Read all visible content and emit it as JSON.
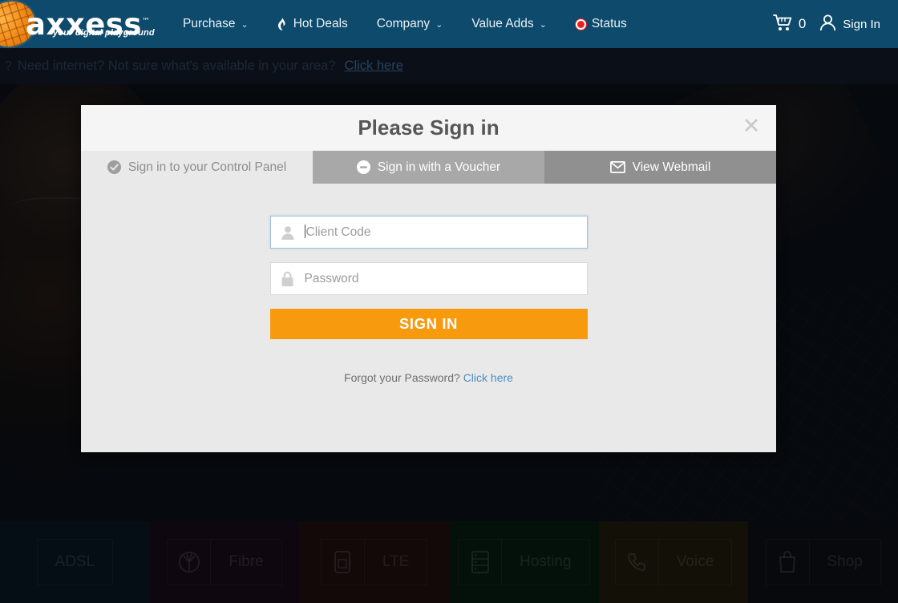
{
  "navbar": {
    "logo": {
      "word": "axxess",
      "tm": "™",
      "tagline": "your digital playground",
      "icon": "globe-icon"
    },
    "items": [
      {
        "label": "Purchase",
        "caret": "⌄",
        "icon": null
      },
      {
        "label": "Hot Deals",
        "caret": "",
        "icon": "flame-icon"
      },
      {
        "label": "Company",
        "caret": "⌄",
        "icon": null
      },
      {
        "label": "Value Adds",
        "caret": "⌄",
        "icon": null
      },
      {
        "label": "Status",
        "caret": "",
        "icon": "status-dot-icon"
      }
    ],
    "cart": {
      "icon": "cart-icon",
      "count": "0"
    },
    "signin": {
      "icon": "user-icon",
      "label": "Sign In"
    }
  },
  "banner": {
    "question_mark": "?",
    "text": "Need internet? Not sure what's available in your area?",
    "link": "Click here"
  },
  "modal": {
    "title": "Please Sign in",
    "close_icon": "close-icon",
    "tabs": [
      {
        "label": "Sign in to your Control Panel",
        "icon": "check-circle-icon",
        "state": "active"
      },
      {
        "label": "Sign in with a Voucher",
        "icon": "minus-circle-icon",
        "state": "inactive"
      },
      {
        "label": "View Webmail",
        "icon": "envelope-icon",
        "state": "inactive"
      }
    ],
    "fields": [
      {
        "name": "client-code",
        "placeholder": "Client Code",
        "value": "",
        "icon": "user-icon",
        "focused": true
      },
      {
        "name": "password",
        "placeholder": "Password",
        "value": "",
        "icon": "lock-icon",
        "focused": false
      }
    ],
    "submit_label": "SIGN IN",
    "forgot_text": "Forgot your Password?",
    "forgot_link": "Click here"
  },
  "tiles": [
    {
      "label": "ADSL",
      "icon": null
    },
    {
      "label": "Fibre",
      "icon": "fibre-icon"
    },
    {
      "label": "LTE",
      "icon": "sim-icon"
    },
    {
      "label": "Hosting",
      "icon": "server-icon"
    },
    {
      "label": "Voice",
      "icon": "phone-icon"
    },
    {
      "label": "Shop",
      "icon": "bag-icon"
    }
  ],
  "colors": {
    "nav_blue": "#0d4a6b",
    "accent_orange": "#f89a0e",
    "modal_bg": "#e9e9e9",
    "tab_mid": "#a8a8a8",
    "tab_right": "#909090",
    "link_blue": "#4a8fc4",
    "status_red": "#e8231f"
  }
}
